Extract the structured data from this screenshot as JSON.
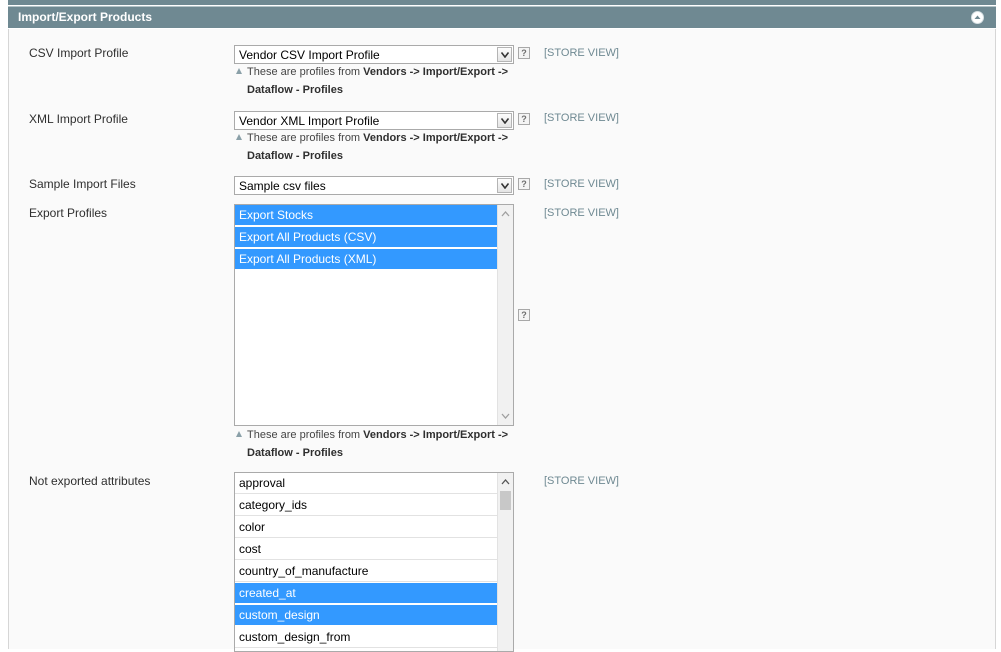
{
  "section": {
    "title": "Import/Export Products"
  },
  "csv_import": {
    "label": "CSV Import Profile",
    "value": "Vendor CSV Import Profile",
    "scope": "[STORE VIEW]",
    "note_prefix": "These are profiles from",
    "note_bold": "Vendors -> Import/Export ->",
    "note_line2": "Dataflow - Profiles"
  },
  "xml_import": {
    "label": "XML Import Profile",
    "value": "Vendor XML Import Profile",
    "scope": "[STORE VIEW]",
    "note_prefix": "These are profiles from",
    "note_bold": "Vendors -> Import/Export ->",
    "note_line2": "Dataflow - Profiles"
  },
  "sample_files": {
    "label": "Sample Import Files",
    "value": "Sample csv files",
    "scope": "[STORE VIEW]"
  },
  "export_profiles": {
    "label": "Export Profiles",
    "scope": "[STORE VIEW]",
    "options": [
      {
        "label": "Export Stocks",
        "selected": true
      },
      {
        "label": "Export All Products (CSV)",
        "selected": true
      },
      {
        "label": "Export All Products (XML)",
        "selected": true
      }
    ],
    "note_prefix": "These are profiles from",
    "note_bold": "Vendors -> Import/Export ->",
    "note_line2": "Dataflow - Profiles"
  },
  "not_exported": {
    "label": "Not exported attributes",
    "scope": "[STORE VIEW]",
    "options": [
      {
        "label": "approval",
        "selected": false
      },
      {
        "label": "category_ids",
        "selected": false
      },
      {
        "label": "color",
        "selected": false
      },
      {
        "label": "cost",
        "selected": false
      },
      {
        "label": "country_of_manufacture",
        "selected": false
      },
      {
        "label": "created_at",
        "selected": true
      },
      {
        "label": "custom_design",
        "selected": true
      },
      {
        "label": "custom_design_from",
        "selected": false
      }
    ]
  },
  "help_glyph": "?",
  "colors": {
    "header": "#6f8992",
    "selected": "#3399ff",
    "scope_text": "#6f8992"
  },
  "icons": [
    "collapse-up-icon",
    "dropdown-arrow-icon",
    "help-icon",
    "note-arrow-icon",
    "scroll-up-icon",
    "scroll-down-icon"
  ]
}
